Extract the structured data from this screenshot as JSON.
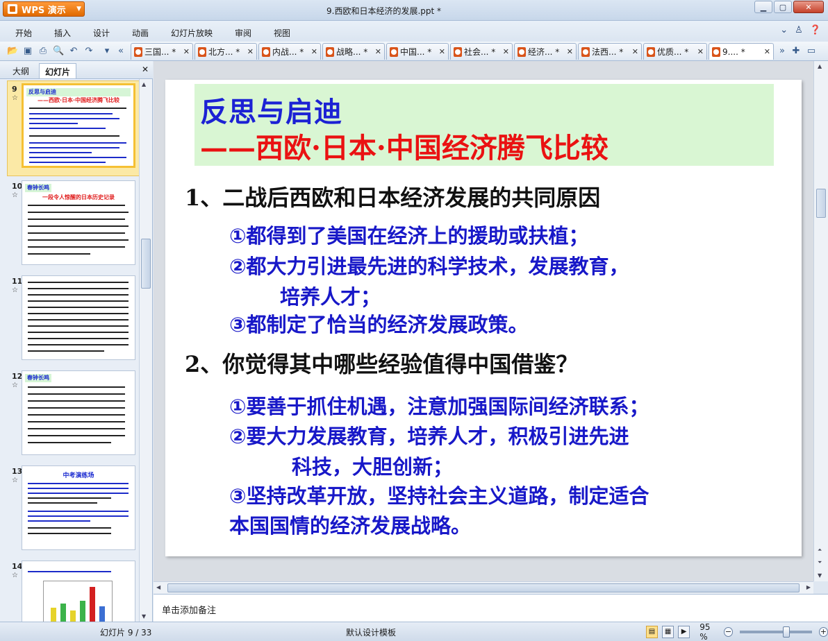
{
  "app": {
    "button_label": "WPS 演示",
    "window_title": "9.西欧和日本经济的发展.ppt *"
  },
  "menu": [
    "开始",
    "插入",
    "设计",
    "动画",
    "幻灯片放映",
    "审阅",
    "视图"
  ],
  "doc_tabs": [
    "三国... *",
    "北方... *",
    "内战... *",
    "战略... *",
    "中国... *",
    "社会... *",
    "经济... *",
    "法西... *",
    "优质... *",
    "9.... *"
  ],
  "left_panel": {
    "tabs": [
      "大纲",
      "幻灯片"
    ],
    "thumbnails": [
      {
        "number": "9",
        "header": "反思与启迪",
        "sub": "——西欧·日本·中国经济腾飞比较"
      },
      {
        "number": "10",
        "header": "春钟长鸣",
        "sub": "一段令人惊醒的日本历史记录"
      },
      {
        "number": "11",
        "header": "",
        "sub": ""
      },
      {
        "number": "12",
        "header": "春钟长鸣",
        "sub": ""
      },
      {
        "number": "13",
        "header": "中考演练场",
        "sub": ""
      },
      {
        "number": "14",
        "header": "",
        "sub": ""
      }
    ]
  },
  "slide": {
    "title_line1": "反思与启迪",
    "title_line2": "——西欧·日本·中国经济腾飞比较",
    "q1": "1、二战后西欧和日本经济发展的共同原因",
    "q1_answers": [
      "①都得到了美国在经济上的援助或扶植；",
      "②都大力引进最先进的科学技术，发展教育，",
      "培养人才；",
      "③都制定了恰当的经济发展政策。"
    ],
    "q2": "2、你觉得其中哪些经验值得中国借鉴？",
    "q2_answers": [
      "①要善于抓住机遇，注意加强国际间经济联系；",
      "②要大力发展教育，培养人才，积极引进先进",
      "科技，大胆创新；",
      "③坚持改革开放，坚持社会主义道路，制定适合",
      "本国国情的经济发展战略。"
    ]
  },
  "notes_placeholder": "单击添加备注",
  "status": {
    "slide_counter": "幻灯片 9 / 33",
    "template": "默认设计模板",
    "zoom": "95 %"
  }
}
